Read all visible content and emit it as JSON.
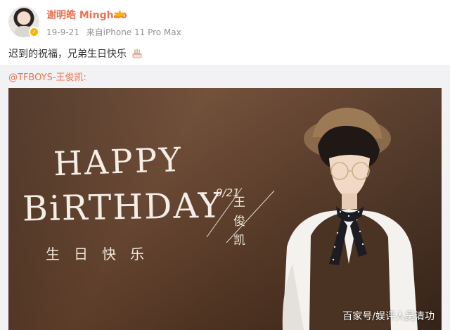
{
  "post": {
    "username": "谢明皓 Minghao",
    "date": "19-9-21",
    "source": "来自iPhone 11 Pro Max",
    "text": "迟到的祝福，兄弟生日快乐"
  },
  "repost": {
    "author": "@TFBOYS-王俊凯:",
    "banner": {
      "line1": "HAPPY",
      "line2": "BiRTHDAY",
      "cn_greeting": "生日快乐",
      "date": "9/21",
      "name": "王俊凯"
    }
  },
  "watermark": "百家号/娱评人吴清功",
  "icons": {
    "verified": "verified-badge-icon",
    "crown": "crown-icon",
    "cake": "cake-emoji-icon"
  },
  "colors": {
    "username": "#eb7350",
    "meta": "#939393",
    "banner_brown": "#5a3a26"
  }
}
